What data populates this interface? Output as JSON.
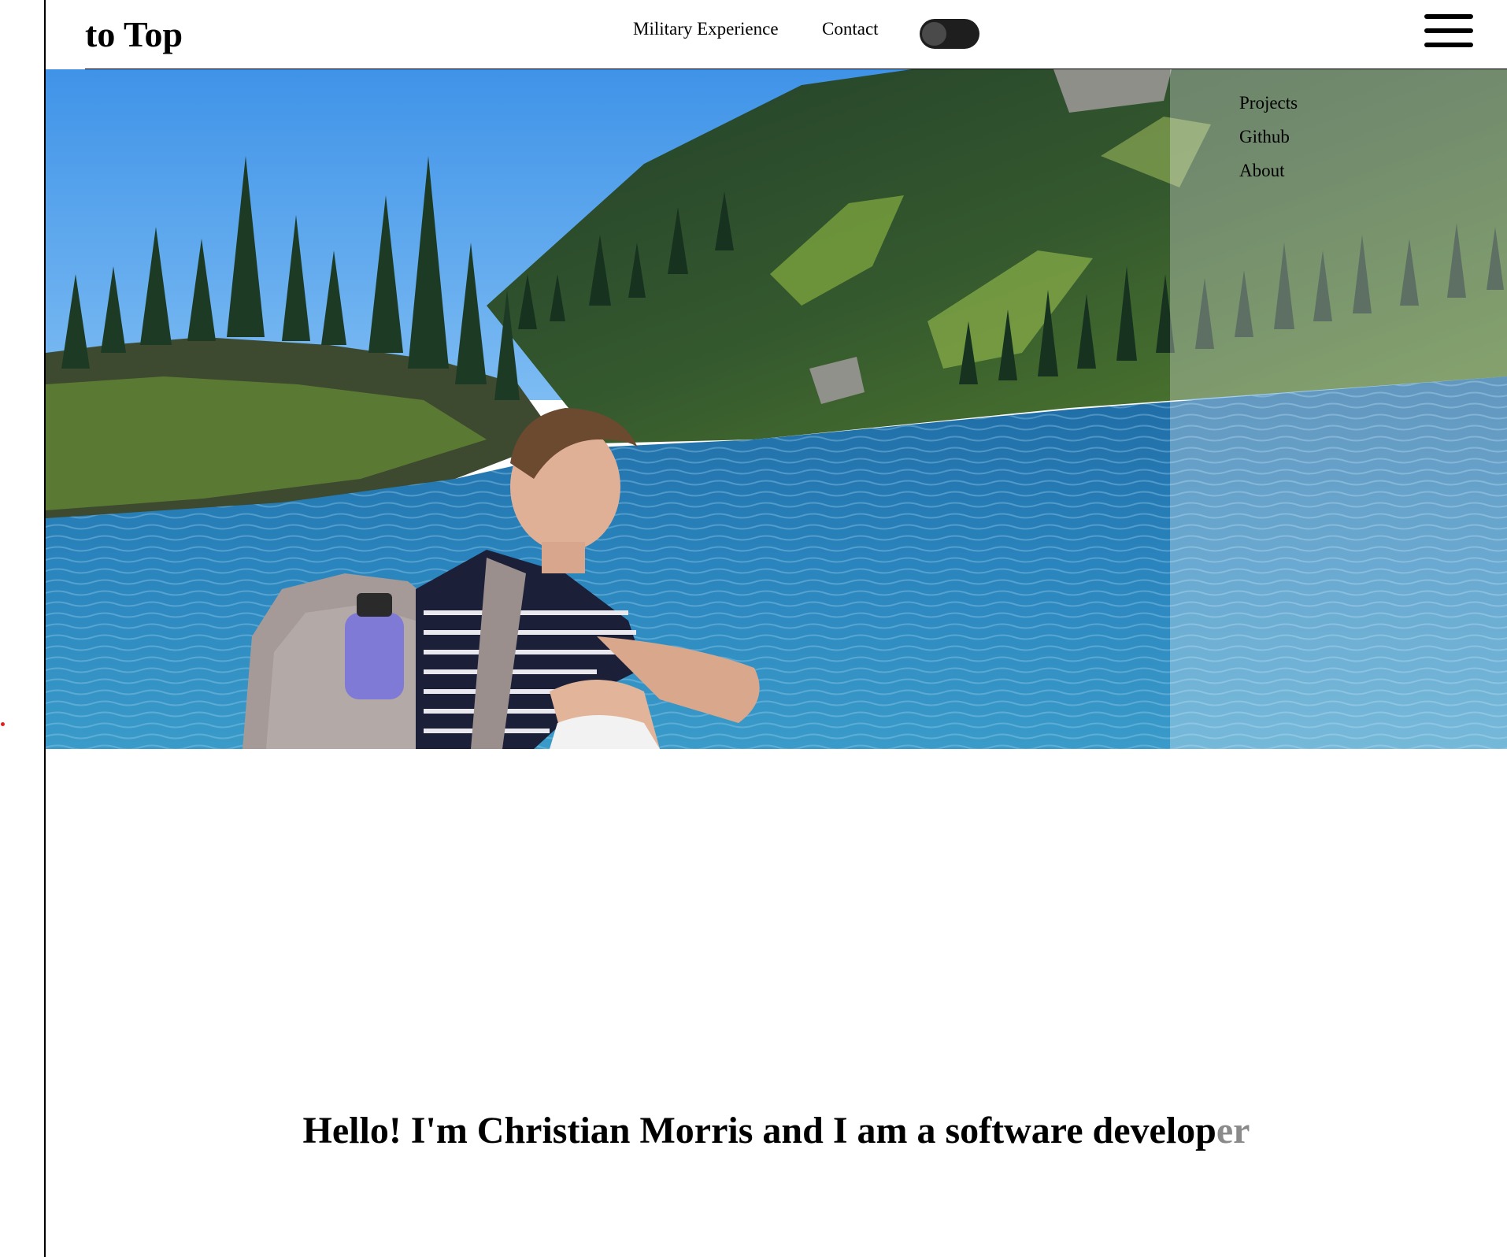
{
  "header": {
    "logo_text": "to Top",
    "nav_links": [
      "Military Experience",
      "Contact"
    ],
    "theme_toggle": {
      "state": "off"
    },
    "menu_icon": "hamburger-menu-icon"
  },
  "side_menu": {
    "items": [
      "Projects",
      "Github",
      "About"
    ]
  },
  "hero": {
    "image_subject": "man with backpack sitting by a mountain lake"
  },
  "intro": {
    "text_main": "Hello! I'm Christian Morris and I am a software develop",
    "text_faded": "er"
  },
  "colors": {
    "page_background": "#ffffff",
    "text": "#000000",
    "toggle_track": "#1e1e1e",
    "toggle_knob": "#4a4a4a",
    "faded_text": "#8a8a8a"
  }
}
